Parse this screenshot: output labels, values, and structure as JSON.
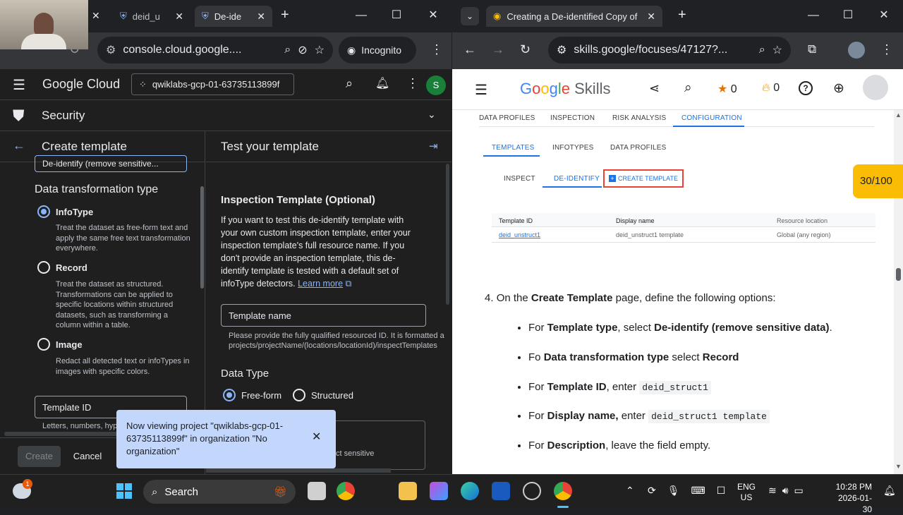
{
  "left": {
    "tabs": [
      {
        "label": "deid_u"
      },
      {
        "label": "De-ide"
      }
    ],
    "url": "console.cloud.google....",
    "incognito": "Incognito",
    "brand": "Google Cloud",
    "project": "qwiklabs-gcp-01-63735113899f",
    "avatar": "S",
    "section": "Security",
    "create_title": "Create template",
    "test_title": "Test your template",
    "truncated_field": "De-identify (remove sensitive...",
    "dtt_heading": "Data transformation type",
    "options": [
      {
        "label": "InfoType",
        "desc": "Treat the dataset as free-form text and apply the same free text transformation everywhere."
      },
      {
        "label": "Record",
        "desc": "Treat the dataset as structured. Transformations can be applied to specific locations within structured datasets, such as transforming a column within a table."
      },
      {
        "label": "Image",
        "desc": "Redact all detected text or infoTypes in images with specific colors."
      }
    ],
    "template_id_placeholder": "Template ID",
    "template_id_hint": "Letters, numbers, hyph",
    "create_btn": "Create",
    "cancel_btn": "Cancel",
    "insp_heading": "Inspection Template (Optional)",
    "insp_text": "If you want to test this de-identify template with your own custom inspection template, enter your inspection template's full resource name. If you don't provide an inspection template, this de-identify template is tested with a default set of infoType detectors.",
    "learn_more": "Learn more",
    "template_name_placeholder": "Template name",
    "template_name_hint1": "Please provide the fully qualified resourced ID. It is formatted a",
    "template_name_hint2": "projects/projectName/(locations/locationId)/inspectTemplates",
    "data_type_heading": "Data Type",
    "data_types": [
      "Free-form",
      "Structured"
    ],
    "partial_text": "ct sensitive",
    "toast": "Now viewing project \"qwiklabs-gcp-01-63735113899f\" in organization \"No organization\""
  },
  "right": {
    "tab_title": "Creating a De-identified Copy of D",
    "url": "skills.google/focuses/47127?...",
    "logo": [
      "G",
      "o",
      "o",
      "g",
      "l",
      "e",
      " Skills"
    ],
    "stars": "0",
    "flames": "0",
    "score": "30/100",
    "top_tabs": [
      "DATA PROFILES",
      "INSPECTION",
      "RISK ANALYSIS",
      "CONFIGURATION"
    ],
    "sub_tabs": [
      "TEMPLATES",
      "INFOTYPES",
      "DATA PROFILES"
    ],
    "sub_sub_tabs": [
      "INSPECT",
      "DE-IDENTIFY"
    ],
    "create_template": "CREATE TEMPLATE",
    "table": {
      "headers": [
        "Template ID",
        "Display name",
        "Resource location"
      ],
      "row": [
        "deid_unstruct1",
        "deid_unstruct1 template",
        "Global (any region)"
      ]
    },
    "step_num": "4.",
    "step": {
      "a": "On the ",
      "b": "Create Template",
      "c": " page, define the following options:"
    },
    "bullets": [
      {
        "a": "For ",
        "b": "Template type",
        ",c": "",
        "c": ", select ",
        "d": "De-identify (remove sensitive data)",
        "e": "."
      },
      {
        "a": "Fo ",
        "b": "Data transformation type",
        "c": " select ",
        "d": "Record",
        "e": ""
      },
      {
        "a": "For ",
        "b": "Template ID",
        "c": ", enter ",
        "code": "deid_struct1"
      },
      {
        "a": "For ",
        "b": "Display name,",
        "c": " enter ",
        "code": "deid_struct1 template"
      },
      {
        "a": "For ",
        "b": "Description",
        "c": ", leave the field empty.",
        "d": "",
        "e": ""
      }
    ]
  },
  "taskbar": {
    "search": "Search",
    "lang1": "ENG",
    "lang2": "US",
    "time": "10:28 PM",
    "date": "2026-01-30",
    "badge": "1"
  },
  "colors": {
    "accent": "#8ab4f8",
    "gcp_bg": "#1f1f1f",
    "skills_blue": "#1a73e8",
    "score_bg": "#fbbc04"
  }
}
